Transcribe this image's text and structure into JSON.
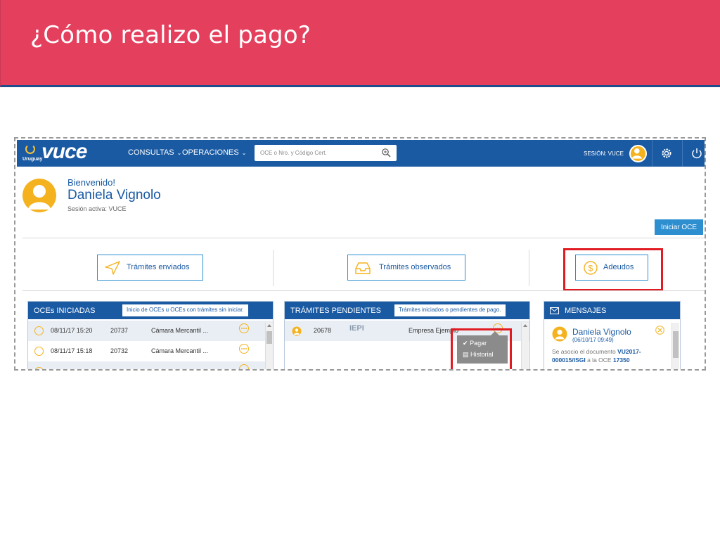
{
  "slide": {
    "title": "¿Cómo realizo el pago?"
  },
  "nav": {
    "country": "Uruguay",
    "brand": "vuce",
    "menu": [
      "CONSULTAS",
      "OPERACIONES"
    ],
    "search_placeholder": "OCE o Nro. y Código Cert.",
    "session": "SESIÓN: VUCE"
  },
  "welcome": {
    "greeting": "Bienvenido!",
    "user": "Daniela Vignolo",
    "session_active": "Sesión activa: VUCE"
  },
  "iniciar_oce": "Iniciar OCE",
  "actions": [
    "Trámites enviados",
    "Trámites observados",
    "Adeudos"
  ],
  "panels": {
    "oces": {
      "title": "OCEs INICIADAS",
      "tag": "Inicio de OCEs u OCEs con trámites sin iniciar.",
      "rows": [
        {
          "date": "08/11/17 15:20",
          "id": "20737",
          "entity": "Cámara Mercantil ..."
        },
        {
          "date": "08/11/17 15:18",
          "id": "20732",
          "entity": "Cámara Mercantil ..."
        }
      ]
    },
    "tramites": {
      "title": "TRÁMITES PENDIENTES",
      "tag": "Trámites iniciados o pendientes de pago.",
      "row": {
        "id": "20678",
        "org": "IEPI",
        "entity": "Empresa Ejemplo"
      },
      "popup": [
        "Pagar",
        "Historial"
      ]
    },
    "mensajes": {
      "title": "MENSAJES",
      "name": "Daniela Vignolo",
      "date": "(06/10/17 09:49)",
      "text_prefix": "Se asocio el documento ",
      "doc": "VU2017-000015/ISGI",
      "text_mid": " a la OCE ",
      "oce": "17350"
    }
  },
  "colors": {
    "title_bg": "#e4405e",
    "nav_bg": "#1a5aa3",
    "accent": "#f5b21f",
    "highlight": "#e11b22"
  }
}
